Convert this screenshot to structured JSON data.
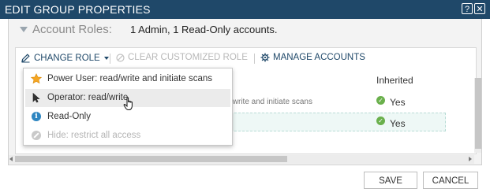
{
  "window": {
    "title": "EDIT GROUP PROPERTIES",
    "help_glyph": "?",
    "close_glyph": "✕"
  },
  "roles": {
    "label": "Account Roles:",
    "summary": "1 Admin, 1 Read-Only accounts."
  },
  "toolbar": {
    "change_role": "CHANGE ROLE",
    "clear_customized_role": "CLEAR CUSTOMIZED ROLE",
    "manage_accounts": "MANAGE ACCOUNTS"
  },
  "table": {
    "inherited_header": "Inherited",
    "rows": [
      {
        "role_fragment": "/write and initiate scans",
        "inherited": "Yes"
      },
      {
        "role_fragment": "",
        "inherited": "Yes"
      }
    ]
  },
  "menu": {
    "items": [
      {
        "label": "Power User: read/write and initiate scans",
        "icon": "star-icon",
        "enabled": true
      },
      {
        "label": "Operator: read/write",
        "icon": "pointer-icon",
        "enabled": true,
        "hovered": true
      },
      {
        "label": "Read-Only",
        "icon": "info-icon",
        "enabled": true
      },
      {
        "label": "Hide: restrict all access",
        "icon": "no-access-icon",
        "enabled": false
      }
    ]
  },
  "footer": {
    "save": "SAVE",
    "cancel": "CANCEL"
  },
  "colors": {
    "titlebar": "#1f4869",
    "link": "#1f4869",
    "check": "#6ab04c",
    "info": "#2e86c1",
    "star": "#f5a623"
  }
}
